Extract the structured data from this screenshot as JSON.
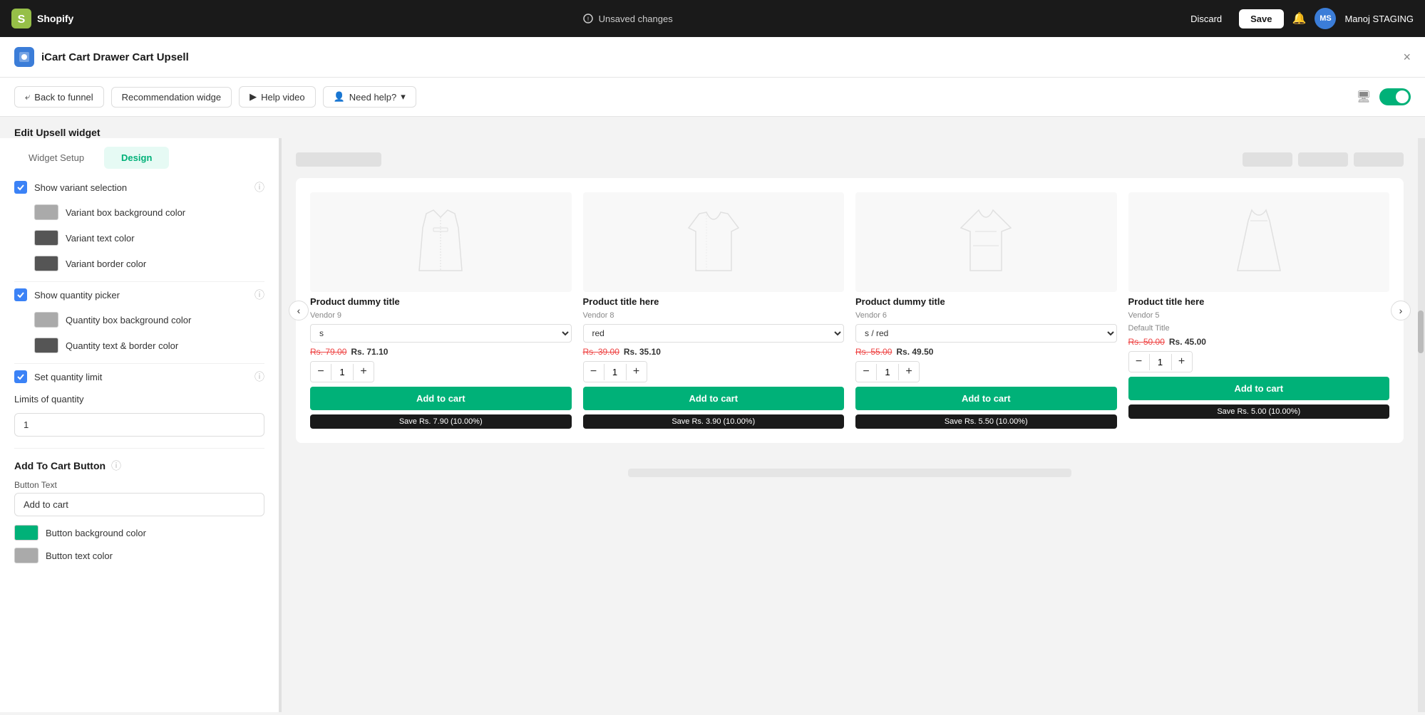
{
  "topnav": {
    "brand": "shopify",
    "status": "Unsaved changes",
    "discard_label": "Discard",
    "save_label": "Save",
    "user_initials": "MS",
    "user_name": "Manoj STAGING"
  },
  "modal": {
    "title": "iCart Cart Drawer Cart Upsell",
    "close_label": "×"
  },
  "toolbar": {
    "back_label": "Back to funnel",
    "widget_label": "Recommendation widge",
    "help_label": "Help video",
    "help_icon": "▶",
    "need_help_label": "Need help?",
    "chevron": "▾"
  },
  "edit_title": "Edit Upsell widget",
  "tabs": {
    "setup_label": "Widget Setup",
    "design_label": "Design"
  },
  "settings": {
    "show_variant_selection": {
      "label": "Show variant selection",
      "checked": true
    },
    "variant_box_bg": {
      "label": "Variant box background color",
      "color": "#aaaaaa"
    },
    "variant_text_color": {
      "label": "Variant text color",
      "color": "#555555"
    },
    "variant_border_color": {
      "label": "Variant border color",
      "color": "#555555"
    },
    "show_qty_picker": {
      "label": "Show quantity picker",
      "checked": true
    },
    "qty_box_bg": {
      "label": "Quantity box background color",
      "color": "#aaaaaa"
    },
    "qty_text_border": {
      "label": "Quantity text & border color",
      "color": "#555555"
    },
    "set_qty_limit": {
      "label": "Set quantity limit",
      "checked": true
    },
    "limits_label": "Limits of quantity",
    "limits_value": "1",
    "add_to_cart_section": {
      "title": "Add To Cart Button",
      "button_text_label": "Button Text",
      "button_text_value": "Add to cart",
      "btn_bg_label": "Button background color",
      "btn_bg_color": "#00b178",
      "btn_text_label": "Button text color",
      "btn_text_color": "#aaaaaa"
    }
  },
  "preview": {
    "header_bar_visible": true,
    "carousel_left": "‹",
    "carousel_right": "›",
    "products": [
      {
        "title": "Product dummy title",
        "vendor": "Vendor 9",
        "variant": "s",
        "price_original": "Rs. 79.00",
        "price_discounted": "Rs. 71.10",
        "qty": "1",
        "add_to_cart": "Add to cart",
        "save_text": "Save Rs. 7.90 (10.00%)"
      },
      {
        "title": "Product title here",
        "vendor": "Vendor 8",
        "variant": "red",
        "price_original": "Rs. 39.00",
        "price_discounted": "Rs. 35.10",
        "qty": "1",
        "add_to_cart": "Add to cart",
        "save_text": "Save Rs. 3.90 (10.00%)"
      },
      {
        "title": "Product dummy title",
        "vendor": "Vendor 6",
        "variant": "s / red",
        "price_original": "Rs. 55.00",
        "price_discounted": "Rs. 49.50",
        "qty": "1",
        "add_to_cart": "Add to cart",
        "save_text": "Save Rs. 5.50 (10.00%)"
      },
      {
        "title": "Product title here",
        "vendor": "Vendor 5",
        "variant": "Default Title",
        "price_original": "Rs. 50.00",
        "price_discounted": "Rs. 45.00",
        "qty": "1",
        "add_to_cart": "Add to cart",
        "save_text": "Save Rs. 5.00 (10.00%)"
      }
    ]
  }
}
